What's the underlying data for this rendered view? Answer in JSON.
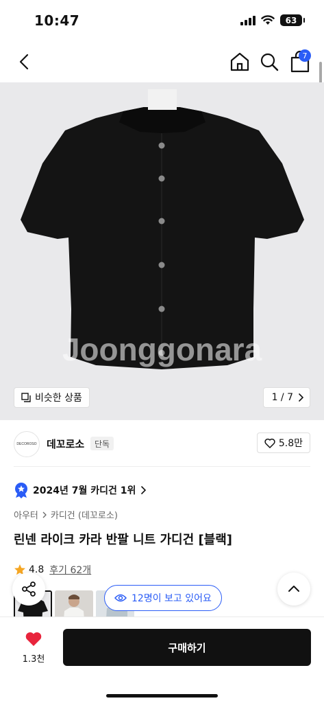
{
  "status_bar": {
    "time": "10:47",
    "battery": "63"
  },
  "nav": {
    "cart_count": "7"
  },
  "gallery": {
    "watermark": "Joonggonara",
    "similar_label": "비슷한 상품",
    "page_counter": "1 / 7"
  },
  "brand": {
    "logo_text": "DECOROSO",
    "name": "데꼬로소",
    "tag": "단독",
    "likes": "5.8만"
  },
  "ranking": {
    "text": "2024년 7월 카디건 1위"
  },
  "breadcrumb": {
    "category": "아우터",
    "subcategory": "카디건 (데꼬로소)"
  },
  "product": {
    "title": "린넨 라이크 카라 반팔 니트 가디건 [블랙]",
    "rating": "4.8",
    "reviews": "후기 62개"
  },
  "viewers": {
    "text": "12명이 보고 있어요"
  },
  "bottom": {
    "wish_count": "1.3천",
    "buy_label": "구매하기"
  },
  "colors": {
    "accent": "#2a5cf6",
    "heart": "#e8243c",
    "star": "#f5a623"
  }
}
